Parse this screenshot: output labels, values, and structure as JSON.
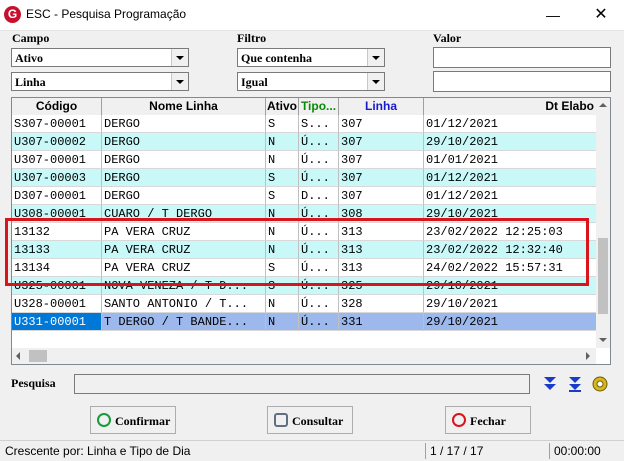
{
  "window": {
    "title": "ESC - Pesquisa Programação",
    "minimize": "—",
    "close": "✕"
  },
  "filters": {
    "campo_label": "Campo",
    "filtro_label": "Filtro",
    "valor_label": "Valor",
    "campo1": "Ativo",
    "campo2": "Linha",
    "filtro1": "Que contenha",
    "filtro2": "Igual"
  },
  "grid": {
    "headers": [
      "Código",
      "Nome Linha",
      "Ativo",
      "Tipo...",
      "Linha",
      "Dt Elabo"
    ],
    "header_colors": [
      "#000000",
      "#000000",
      "#000000",
      "#0a8a0a",
      "#1a1acd",
      "#000000"
    ],
    "rows": [
      {
        "c": [
          "S307-00001",
          "DERGO",
          "S",
          "S...",
          "307",
          "01/12/2021"
        ],
        "bg": "#ffffff"
      },
      {
        "c": [
          "U307-00002",
          "DERGO",
          "N",
          "Ú...",
          "307",
          "29/10/2021"
        ],
        "bg": "#c8f8f8"
      },
      {
        "c": [
          "U307-00001",
          "DERGO",
          "N",
          "Ú...",
          "307",
          "01/01/2021"
        ],
        "bg": "#ffffff"
      },
      {
        "c": [
          "U307-00003",
          "DERGO",
          "S",
          "Ú...",
          "307",
          "01/12/2021"
        ],
        "bg": "#c8f8f8"
      },
      {
        "c": [
          "D307-00001",
          "DERGO",
          "S",
          "D...",
          "307",
          "01/12/2021"
        ],
        "bg": "#ffffff"
      },
      {
        "c": [
          "U308-00001",
          "CUARO / T DERGO",
          "N",
          "Ú...",
          "308",
          "29/10/2021"
        ],
        "bg": "#c8f8f8"
      },
      {
        "c": [
          "13132",
          "PA VERA CRUZ",
          "N",
          "Ú...",
          "313",
          "23/02/2022 12:25:03"
        ],
        "bg": "#ffffff"
      },
      {
        "c": [
          "13133",
          "PA VERA CRUZ",
          "N",
          "Ú...",
          "313",
          "23/02/2022 12:32:40"
        ],
        "bg": "#c8f8f8"
      },
      {
        "c": [
          "13134",
          "PA VERA CRUZ",
          "S",
          "Ú...",
          "313",
          "24/02/2022 15:57:31"
        ],
        "bg": "#ffffff"
      },
      {
        "c": [
          "U325-00001",
          "NOVA VENEZA / T D...",
          "S",
          "Ú...",
          "325",
          "29/10/2021"
        ],
        "bg": "#c8f8f8"
      },
      {
        "c": [
          "U328-00001",
          "SANTO ANTONIO / T...",
          "N",
          "Ú...",
          "328",
          "29/10/2021"
        ],
        "bg": "#ffffff"
      },
      {
        "c": [
          "U331-00001",
          "T DERGO / T BANDE...",
          "N",
          "Ú...",
          "331",
          "29/10/2021"
        ],
        "bg": "#9cb8ec",
        "selected": true
      }
    ]
  },
  "search": {
    "label": "Pesquisa",
    "value": ""
  },
  "buttons": {
    "confirm": "Confirmar",
    "consult": "Consultar",
    "close": "Fechar"
  },
  "status": {
    "sort": "Crescente por: Linha e Tipo de Dia",
    "count": "1 / 17 / 17",
    "time": "00:00:00"
  },
  "colors": {
    "highlight": "#d9141b",
    "cyan_row": "#c8f8f8",
    "selected_row": "#9cb8ec",
    "selected_code": "#0078d7"
  }
}
